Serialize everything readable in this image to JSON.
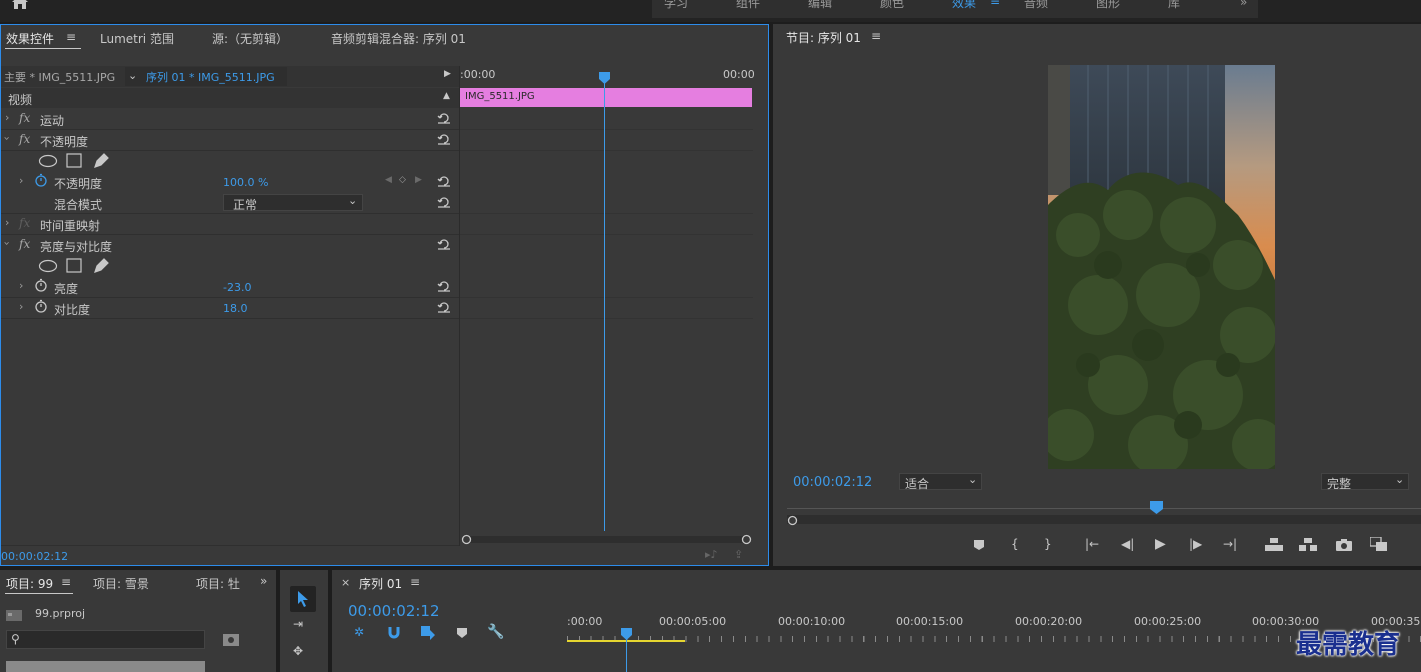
{
  "workspace_tabs": [
    {
      "label": "学习",
      "active": false
    },
    {
      "label": "组件",
      "active": false
    },
    {
      "label": "编辑",
      "active": false
    },
    {
      "label": "颜色",
      "active": false
    },
    {
      "label": "效果",
      "active": true
    },
    {
      "label": "音频",
      "active": false
    },
    {
      "label": "图形",
      "active": false
    },
    {
      "label": "库",
      "active": false
    }
  ],
  "effect_controls": {
    "tabs": [
      "效果控件",
      "Lumetri 范围",
      "源:（无剪辑）",
      "音频剪辑混合器: 序列 01"
    ],
    "master_clip": "主要 * IMG_5511.JPG",
    "sequence_clip": "序列 01 * IMG_5511.JPG",
    "section": "视频",
    "motion": "运动",
    "opacity_group": "不透明度",
    "opacity_param": "不透明度",
    "opacity_value": "100.0 %",
    "blend_mode_label": "混合模式",
    "blend_mode_value": "正常",
    "time_remap": "时间重映射",
    "brightness_group": "亮度与对比度",
    "brightness_label": "亮度",
    "brightness_value": "-23.0",
    "contrast_label": "对比度",
    "contrast_value": "18.0",
    "timecode": "00:00:02:12",
    "mini_timeline": {
      "start": ":00:00",
      "end": "00:00",
      "clip": "IMG_5511.JPG"
    }
  },
  "program": {
    "title": "节目: 序列 01",
    "timecode": "00:00:02:12",
    "fit": "适合",
    "quality": "完整"
  },
  "project": {
    "tabs": [
      "项目: 99",
      "项目: 雪景",
      "项目: 牡"
    ],
    "file": "99.prproj"
  },
  "timeline": {
    "title": "序列 01",
    "timecode": "00:00:02:12",
    "ruler": [
      ":00:00",
      "00:00:05:00",
      "00:00:10:00",
      "00:00:15:00",
      "00:00:20:00",
      "00:00:25:00",
      "00:00:30:00",
      "00:00:35"
    ]
  },
  "watermark": "最需教育",
  "colors": {
    "accent": "#3d9be9",
    "clip": "#e57ee0",
    "panel": "#393939",
    "in_out_bar": "#e6d630"
  }
}
